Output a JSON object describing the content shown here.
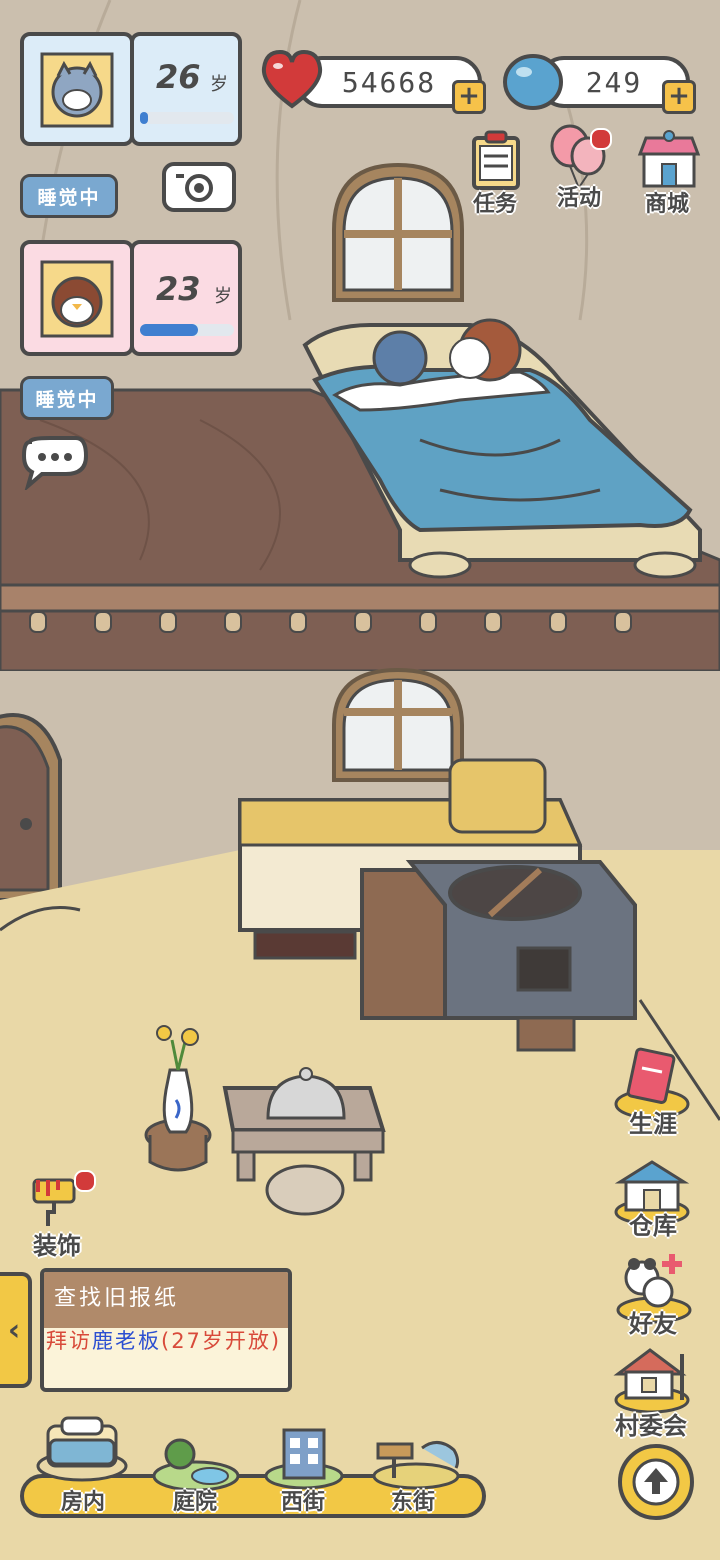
{
  "characters": [
    {
      "name": "wolf",
      "age": "26",
      "unit": "岁",
      "progress": 0.08,
      "status": "睡觉中",
      "card_color": "#dcecf8"
    },
    {
      "name": "penguin",
      "age": "23",
      "unit": "岁",
      "progress": 0.62,
      "status": "睡觉中",
      "card_color": "#fbdbe3"
    }
  ],
  "currency": {
    "hearts": "54668",
    "gems": "249"
  },
  "top_menu": {
    "tasks": "任务",
    "events": "活动",
    "shop": "商城"
  },
  "side_menu": {
    "decorate": "装饰",
    "career": "生涯",
    "storage": "仓库",
    "friends": "好友",
    "village_committee": "村委会"
  },
  "quest": {
    "title": "查找旧报纸",
    "action": "拜访",
    "npc": "鹿老板",
    "condition": "(27岁开放)"
  },
  "bottom_nav": {
    "indoor": "房内",
    "courtyard": "庭院",
    "west_street": "西街",
    "east_street": "东街"
  },
  "colors": {
    "accent_blue": "#7aa8d0",
    "heart_red": "#d23a3a",
    "gem_blue": "#5aa3cf",
    "plus_yellow": "#f6c24a",
    "quest_red": "#d84a3a",
    "npc_blue": "#2c4fd1"
  }
}
